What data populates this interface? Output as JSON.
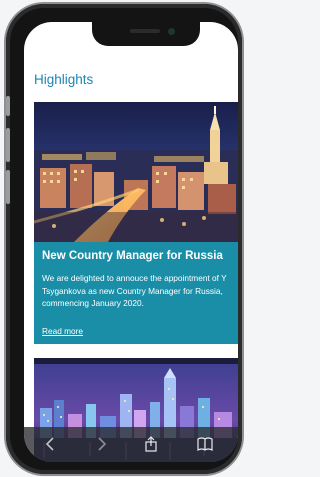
{
  "section": {
    "title": "Highlights"
  },
  "article": {
    "title": "New Country Manager for Russia",
    "description_lines": [
      "We are delighted to annouce the appointment of Y",
      "Tsygankova as new Country Manager for Russia,",
      "commencing January 2020."
    ],
    "read_more": "Read more"
  },
  "browser_toolbar": {
    "icons": [
      "back-icon",
      "forward-icon",
      "share-icon",
      "bookmarks-icon"
    ]
  },
  "colors": {
    "accent": "#1d86b3",
    "card_background": "#1b8ea7"
  }
}
